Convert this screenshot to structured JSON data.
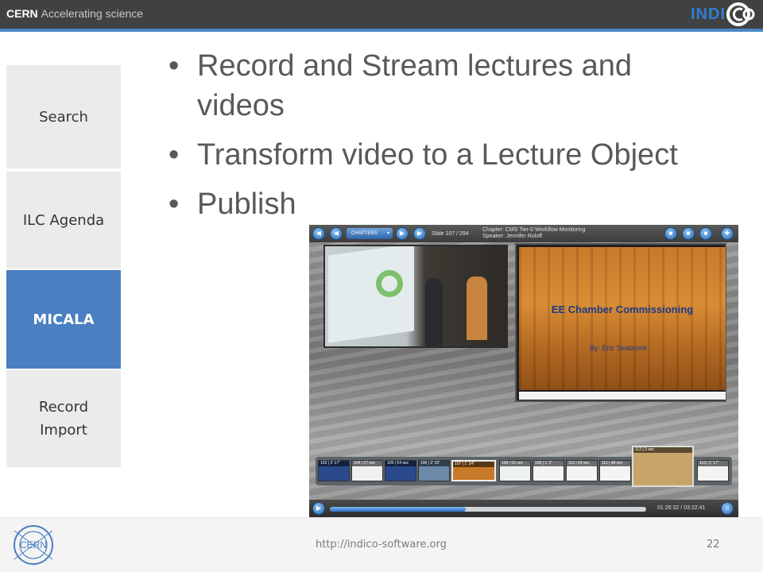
{
  "header": {
    "brand_bold": "CERN",
    "brand_tagline": "Accelerating science",
    "logo_text": "INDI"
  },
  "sidebar": {
    "items": [
      {
        "label": "Search",
        "active": false
      },
      {
        "label": "ILC Agenda",
        "active": false
      },
      {
        "label": "MICALA",
        "active": true
      },
      {
        "label": "Record Import",
        "active": false
      }
    ]
  },
  "content": {
    "bullets": [
      "Record and Stream lectures and videos",
      "Transform video to a Lecture Object",
      "Publish"
    ]
  },
  "player": {
    "chapters_label": "CHAPTERS",
    "slide_counter": "Slide  107 / 294",
    "chapter_line": "Chapter: CMS Tier-0 Workflow Monitoring",
    "speaker_line": "Speaker: Jennifer Roloff",
    "slide_title": "EE Chamber Commissioning",
    "slide_subtitle": "By: Eric Seabrook",
    "thumbnails": [
      "103 | 3' 17\"",
      "104 | 27 sec",
      "105 | 54 sec",
      "106 | 2' 15\"",
      "107 | 1' 24\"",
      "108 | 52 sec",
      "109 | 1' 2\"",
      "110 | 54 sec",
      "111 | 48 sec",
      "112 | 3 sec",
      "113 | 1' 17\""
    ],
    "time_display": "01:26:32 / 03:22:41",
    "progress": 0.43
  },
  "footer": {
    "url": "http://indico-software.org",
    "page_number": "22",
    "logo_text": "CERN"
  },
  "colors": {
    "accent_blue": "#4a7fc1",
    "header_dark": "#414141",
    "bullet_text": "#595959"
  }
}
